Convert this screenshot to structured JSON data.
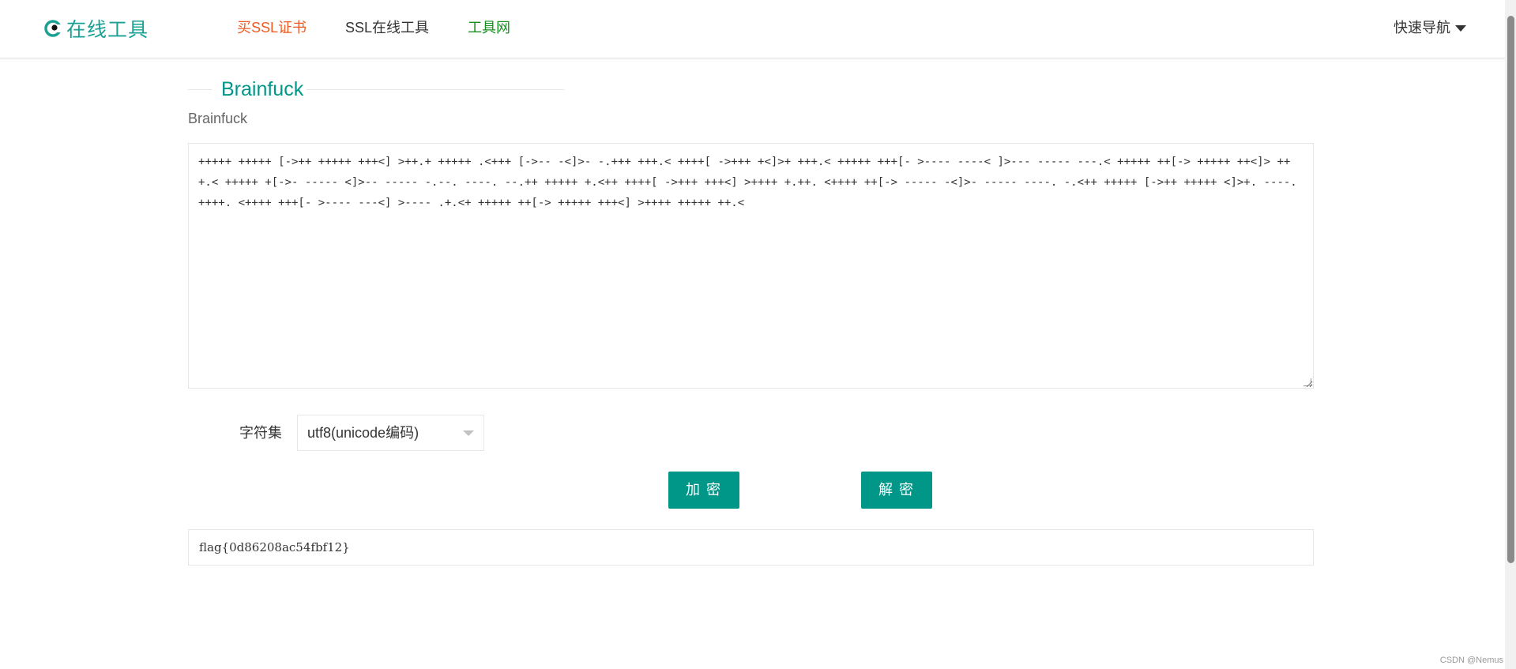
{
  "header": {
    "logo_text": "在线工具",
    "nav": [
      {
        "label": "买SSL证书",
        "color": "#f05a24"
      },
      {
        "label": "SSL在线工具",
        "color": "#333333"
      },
      {
        "label": "工具网",
        "color": "#15901e"
      }
    ],
    "quick_nav_label": "快速导航"
  },
  "main": {
    "title": "Brainfuck",
    "subtitle": "Brainfuck",
    "input_text": "+++++ +++++ [->++ +++++ +++<] >++.+ +++++ .<+++ [->-- -<]>- -.+++ +++.< ++++[ ->+++ +<]>+ +++.< +++++ +++[- >---- ----< ]>--- ----- ---.< +++++ ++[-> +++++ ++<]> +++.< +++++ +[->- ----- <]>-- ----- -.--. ----. --.++ +++++ +.<++ ++++[ ->+++ +++<] >++++ +.++. <++++ ++[-> ----- -<]>- ----- ----. -.<++ +++++ [->++ +++++ <]>+. ----. ++++. <++++ +++[- >---- ---<] >---- .+.<+ +++++ ++[-> +++++ +++<] >++++ +++++ ++.<",
    "charset_label": "字符集",
    "charset_value": "utf8(unicode编码)",
    "encrypt_label": "加密",
    "decrypt_label": "解密",
    "output_text": "flag{0d86208ac54fbf12}"
  },
  "watermark": "CSDN @Nemus",
  "colors": {
    "accent": "#009688",
    "logo": "#1aa194"
  }
}
